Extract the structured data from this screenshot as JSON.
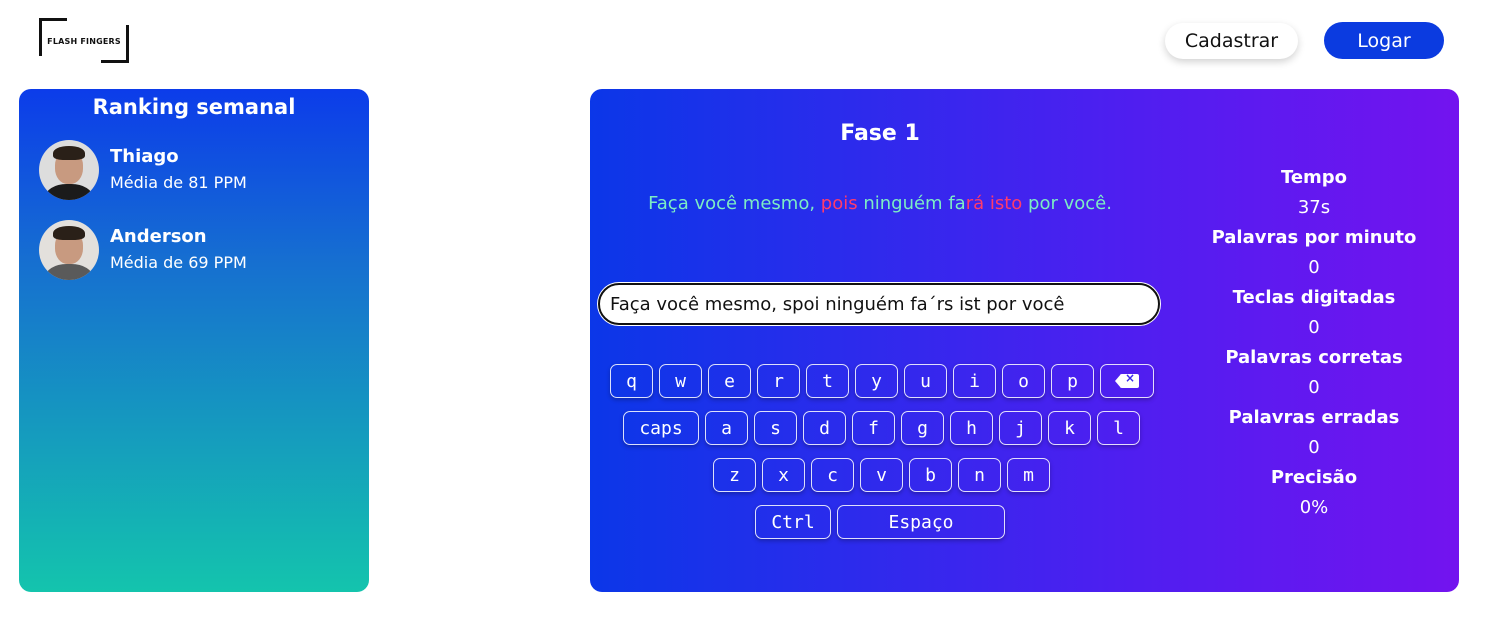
{
  "header": {
    "logo_text": "FLASH FINGERS",
    "register_label": "Cadastrar",
    "login_label": "Logar"
  },
  "ranking": {
    "title": "Ranking semanal",
    "users": [
      {
        "name": "Thiago",
        "average": "Média de 81 PPM"
      },
      {
        "name": "Anderson",
        "average": "Média de 69 PPM"
      }
    ]
  },
  "game": {
    "phase_title": "Fase 1",
    "target_segments": [
      {
        "text": "Faça você mesmo, ",
        "status": "correct"
      },
      {
        "text": "pois",
        "status": "error"
      },
      {
        "text": " ninguém fa",
        "status": "correct"
      },
      {
        "text": "rá isto",
        "status": "error"
      },
      {
        "text": " por você.",
        "status": "correct"
      }
    ],
    "input_value": "Faça você mesmo, spoi ninguém fa´rs ist por você",
    "keyboard": {
      "row1": [
        "q",
        "w",
        "e",
        "r",
        "t",
        "y",
        "u",
        "i",
        "o",
        "p"
      ],
      "row2_caps": "caps",
      "row2": [
        "a",
        "s",
        "d",
        "f",
        "g",
        "h",
        "j",
        "k",
        "l"
      ],
      "row3": [
        "z",
        "x",
        "c",
        "v",
        "b",
        "n",
        "m"
      ],
      "ctrl_label": "Ctrl",
      "space_label": "Espaço"
    },
    "stats": [
      {
        "label": "Tempo",
        "value": "37s"
      },
      {
        "label": "Palavras por minuto",
        "value": "0"
      },
      {
        "label": "Teclas digitadas",
        "value": "0"
      },
      {
        "label": "Palavras corretas",
        "value": "0"
      },
      {
        "label": "Palavras erradas",
        "value": "0"
      },
      {
        "label": "Precisão",
        "value": "0%"
      }
    ]
  },
  "colors": {
    "correct": "#7dedc4",
    "error": "#ff3b6b",
    "primary": "#0b3be0"
  }
}
